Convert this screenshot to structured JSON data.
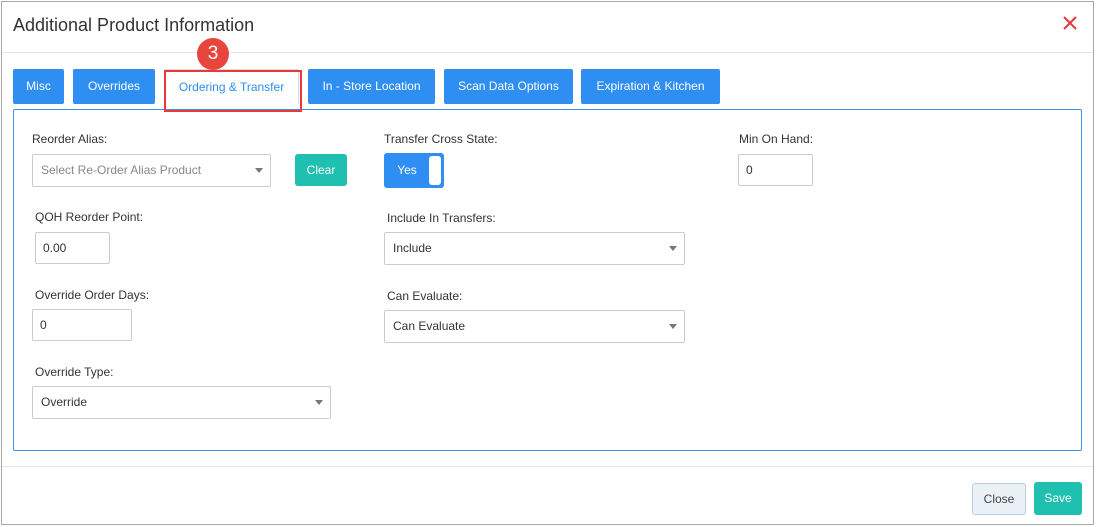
{
  "modal": {
    "title": "Additional Product Information"
  },
  "tabs": [
    {
      "label": "Misc"
    },
    {
      "label": "Overrides"
    },
    {
      "label": "Ordering & Transfer"
    },
    {
      "label": "In - Store Location"
    },
    {
      "label": "Scan Data Options"
    },
    {
      "label": "Expiration & Kitchen"
    }
  ],
  "step_badge": "3",
  "form": {
    "reorder_alias": {
      "label": "Reorder Alias:",
      "placeholder": "Select Re-Order Alias Product",
      "clear_label": "Clear"
    },
    "transfer_cross_state": {
      "label": "Transfer Cross State:",
      "toggle_value": "Yes"
    },
    "min_on_hand": {
      "label": "Min On Hand:",
      "value": "0"
    },
    "qoh_reorder_point": {
      "label": "QOH Reorder Point:",
      "value": "0.00"
    },
    "include_in_transfers": {
      "label": "Include In Transfers:",
      "value": "Include"
    },
    "override_order_days": {
      "label": "Override Order Days:",
      "value": "0"
    },
    "can_evaluate": {
      "label": "Can Evaluate:",
      "value": "Can Evaluate"
    },
    "override_type": {
      "label": "Override Type:",
      "value": "Override"
    }
  },
  "footer": {
    "close_label": "Close",
    "save_label": "Save"
  },
  "colors": {
    "primary": "#2e8ef2",
    "teal": "#1fc0b0",
    "badge": "#e8453c",
    "close_icon": "#e5393b"
  }
}
